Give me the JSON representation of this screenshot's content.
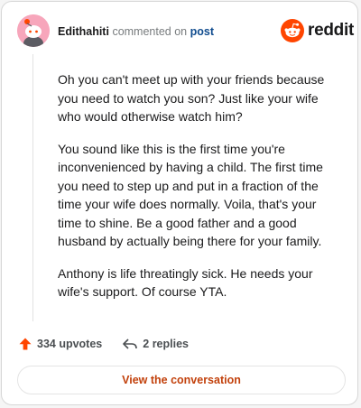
{
  "comment": {
    "username": "Edithahiti",
    "commented_on": "commented on",
    "post_link": "post",
    "paragraphs": [
      "Oh you can't meet up with your friends because you need to watch you son? Just like your wife who would otherwise watch him?",
      "You sound like this is the first time you're inconvenienced by having a child. The first time you need to step up and put in a fraction of the time your wife does normally. Voila, that's your time to shine. Be a good father and a good husband by actually being there for your family.",
      "Anthony is life threatingly sick. He needs your wife's support. Of course YTA."
    ]
  },
  "brand": {
    "name": "reddit",
    "icon": "reddit-snoo-icon",
    "color": "#ff4500"
  },
  "actions": {
    "upvotes": "334 upvotes",
    "upvote_icon": "upvote-arrow-icon",
    "replies": "2 replies",
    "reply_icon": "reply-arrow-icon"
  },
  "cta": {
    "label": "View the conversation"
  },
  "colors": {
    "accent": "#ff4500",
    "link": "#0f4b8e",
    "cta_text": "#c2410c",
    "avatar_bg": "#f7a6bb"
  }
}
